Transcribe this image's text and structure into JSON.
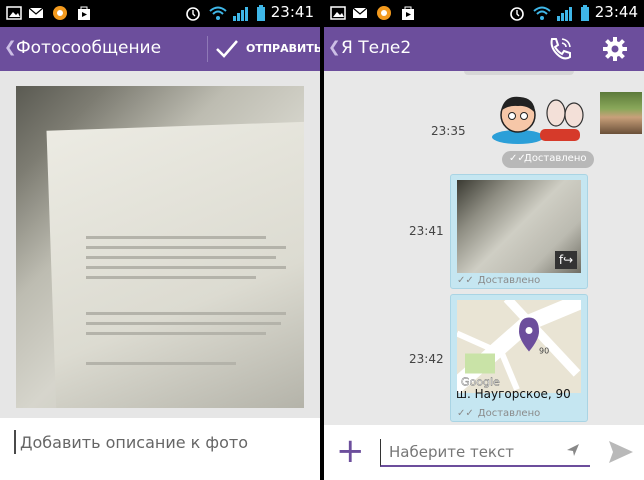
{
  "left": {
    "status": {
      "clock": "23:41"
    },
    "appbar": {
      "title": "Фотосообщение",
      "send_label": "ОТПРАВИТЬ"
    },
    "caption": {
      "placeholder": "Добавить описание к фото"
    }
  },
  "right": {
    "status": {
      "clock": "23:44"
    },
    "appbar": {
      "title": "Я Теле2"
    },
    "messages": [
      {
        "time": "23:35",
        "status": "Доставлено",
        "kind": "sticker"
      },
      {
        "time": "23:41",
        "status": "Доставлено",
        "kind": "photo"
      },
      {
        "time": "23:42",
        "status": "Доставлено",
        "kind": "location",
        "address": "ш. Наугорское, 90",
        "map_labels": [
          "90",
          "Google"
        ]
      }
    ],
    "composer": {
      "placeholder": "Наберите текст"
    }
  },
  "colors": {
    "accent": "#6c4e9c",
    "bubble": "#c5e6f1",
    "status_bar": "#000000"
  }
}
